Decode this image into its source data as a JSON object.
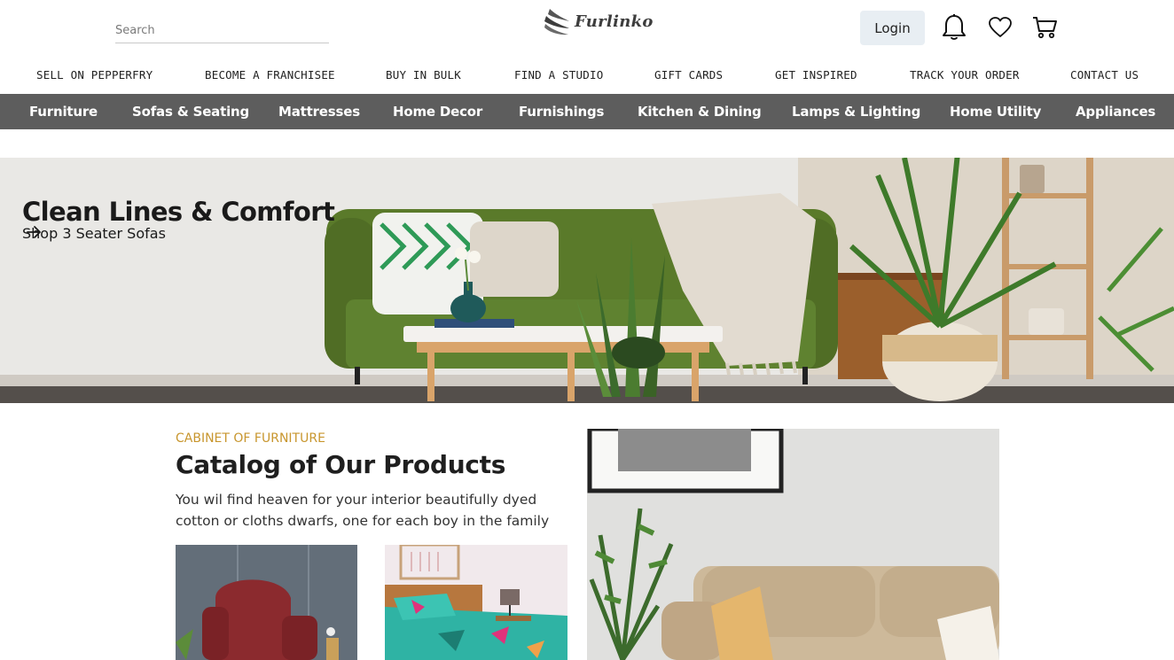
{
  "header": {
    "search_placeholder": "Search",
    "brand_name": "Furlinko",
    "login_label": "Login",
    "icons": [
      "bell-icon",
      "heart-icon",
      "cart-icon"
    ]
  },
  "utility_links": [
    "SELL ON PEPPERFRY",
    "BECOME A FRANCHISEE",
    "BUY IN BULK",
    "FIND A STUDIO",
    "GIFT CARDS",
    "GET INSPIRED",
    "TRACK YOUR ORDER",
    "CONTACT US"
  ],
  "categories": [
    "Furniture",
    "Sofas & Seating",
    "Mattresses",
    "Home Decor",
    "Furnishings",
    "Kitchen & Dining",
    "Lamps & Lighting",
    "Home Utility",
    "Appliances"
  ],
  "hero": {
    "title": "Clean Lines & Comfort",
    "subtitle": "Shop 3 Seater Sofas",
    "arrow_icon": "arrow-right-icon"
  },
  "catalog": {
    "eyebrow": "CABINET OF FURNITURE",
    "title": "Catalog of Our Products",
    "description": "You wil find heaven for your interior beautifully dyed cotton or cloths dwarfs, one for each boy in the family"
  },
  "colors": {
    "nav_background": "#5d5d5d",
    "accent": "#c8962e",
    "login_background": "#e8eef3",
    "sofa_green": "#5a7a2a"
  }
}
